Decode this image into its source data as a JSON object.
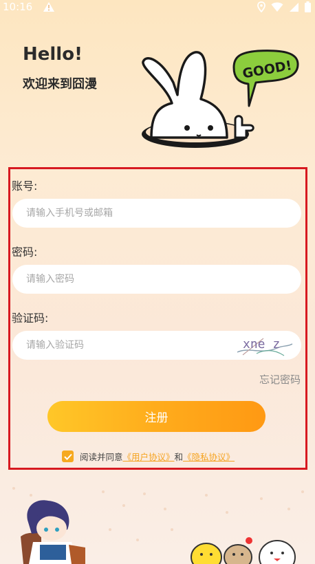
{
  "status": {
    "time": "10:16"
  },
  "header": {
    "greeting": "Hello!",
    "welcome": "欢迎来到囧漫"
  },
  "mascot": {
    "bubble_text": "GOOD!"
  },
  "form": {
    "account_label": "账号:",
    "account_placeholder": "请输入手机号或邮箱",
    "password_label": "密码:",
    "password_placeholder": "请输入密码",
    "captcha_label": "验证码:",
    "captcha_placeholder": "请输入验证码",
    "captcha_text": "xne z",
    "forgot_password": "忘记密码",
    "register_button": "注册",
    "agree_prefix": "阅读并同意",
    "user_agreement": "《用户协议》",
    "and": "和",
    "privacy_policy": "《隐私协议》"
  },
  "colors": {
    "accent": "#ff9913",
    "highlight_border": "#d71920"
  }
}
